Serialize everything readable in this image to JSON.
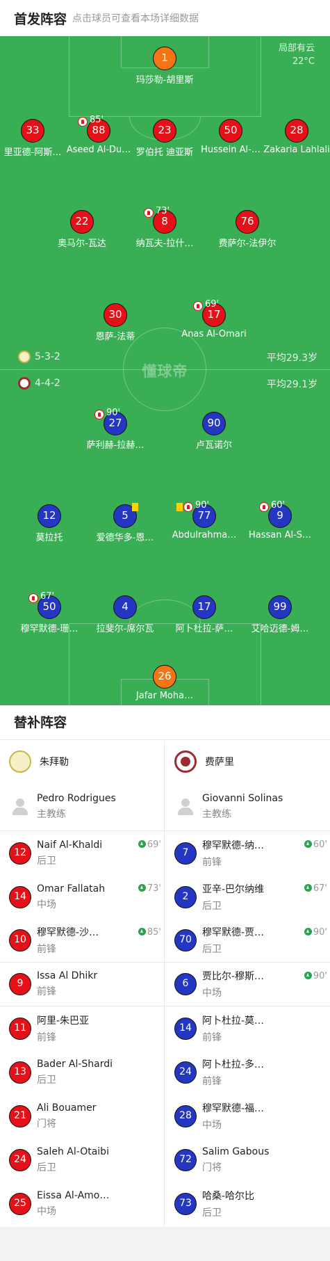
{
  "header": {
    "title": "首发阵容",
    "hint": "点击球员可查看本场详细数据"
  },
  "weather": {
    "desc": "局部有云",
    "temp": "22°C"
  },
  "watermark": "懂球帝",
  "home": {
    "formation": "5-3-2",
    "avg_age": "平均29.3岁",
    "color": "#e51018",
    "players": [
      {
        "no": "1",
        "name": "玛莎勒-胡里斯",
        "pos": "gk"
      },
      {
        "no": "33",
        "name": "里亚德-阿斯…"
      },
      {
        "no": "88",
        "name": "Aseed Al-Du…",
        "sub": "85'"
      },
      {
        "no": "23",
        "name": "罗伯托 迪亚斯"
      },
      {
        "no": "50",
        "name": "Hussein Al-…"
      },
      {
        "no": "28",
        "name": "Zakaria Lahlali"
      },
      {
        "no": "22",
        "name": "奥马尔-瓦达"
      },
      {
        "no": "8",
        "name": "纳瓦夫-拉什…",
        "sub": "73'"
      },
      {
        "no": "76",
        "name": "费萨尔-法伊尔",
        "captain": "c"
      },
      {
        "no": "30",
        "name": "恩萨-法蒂"
      },
      {
        "no": "17",
        "name": "Anas Al-Omari",
        "sub": "69'"
      }
    ]
  },
  "away": {
    "formation": "4-4-2",
    "avg_age": "平均29.1岁",
    "color": "#2437c2",
    "players": [
      {
        "no": "27",
        "name": "萨利赫-拉赫…",
        "sub": "90'"
      },
      {
        "no": "90",
        "name": "卢瓦诺尔",
        "goal": true
      },
      {
        "no": "12",
        "name": "莫拉托"
      },
      {
        "no": "5",
        "name": "爱德华多-恩…",
        "captain": "c",
        "yellow": true
      },
      {
        "no": "77",
        "name": "Abdulrahma…",
        "sub": "90'",
        "yellow": true,
        "assist": true
      },
      {
        "no": "9",
        "name": "Hassan Al-S…",
        "sub": "60'"
      },
      {
        "no": "50",
        "name": "穆罕默德-珊…",
        "sub": "67'"
      },
      {
        "no": "4",
        "name": "拉斐尔-席尔瓦"
      },
      {
        "no": "17",
        "name": "阿卜杜拉-萨…"
      },
      {
        "no": "99",
        "name": "艾哈迈德-姆…"
      },
      {
        "no": "26",
        "name": "Jafar Moha…",
        "pos": "gk"
      }
    ]
  },
  "subs": {
    "title": "替补阵容",
    "left": {
      "team": "朱拜勒",
      "coach": {
        "name": "Pedro Rodrigues",
        "role": "主教练"
      },
      "players": [
        {
          "no": "12",
          "name": "Naif Al-Khaldi",
          "pos": "后卫",
          "min": "69'"
        },
        {
          "no": "14",
          "name": "Omar Fallatah",
          "pos": "中场",
          "min": "73'"
        },
        {
          "no": "10",
          "name": "穆罕默德-沙…",
          "pos": "前锋",
          "min": "85'"
        },
        {
          "no": "9",
          "name": "Issa Al Dhikr",
          "pos": "前锋"
        },
        {
          "no": "11",
          "name": "阿里-朱巴亚",
          "pos": "前锋"
        },
        {
          "no": "13",
          "name": "Bader Al-Shardi",
          "pos": "后卫"
        },
        {
          "no": "21",
          "name": "Ali Bouamer",
          "pos": "门将"
        },
        {
          "no": "24",
          "name": "Saleh Al-Otaibi",
          "pos": "后卫"
        },
        {
          "no": "25",
          "name": "Eissa Al-Amo…",
          "pos": "中场"
        }
      ]
    },
    "right": {
      "team": "费萨里",
      "coach": {
        "name": "Giovanni Solinas",
        "role": "主教练"
      },
      "players": [
        {
          "no": "7",
          "name": "穆罕默德-纳…",
          "pos": "前锋",
          "min": "60'"
        },
        {
          "no": "2",
          "name": "亚辛-巴尔纳维",
          "pos": "后卫",
          "min": "67'"
        },
        {
          "no": "70",
          "name": "穆罕默德-贾…",
          "pos": "后卫",
          "min": "90'"
        },
        {
          "no": "6",
          "name": "贾比尔-穆斯…",
          "pos": "中场",
          "min": "90'"
        },
        {
          "no": "14",
          "name": "阿卜杜拉-莫…",
          "pos": "前锋"
        },
        {
          "no": "24",
          "name": "阿卜杜拉-多…",
          "pos": "前锋"
        },
        {
          "no": "28",
          "name": "穆罕默德-福…",
          "pos": "中场"
        },
        {
          "no": "72",
          "name": "Salim Gabous",
          "pos": "门将"
        },
        {
          "no": "73",
          "name": "哈桑-哈尔比",
          "pos": "后卫"
        }
      ]
    }
  }
}
